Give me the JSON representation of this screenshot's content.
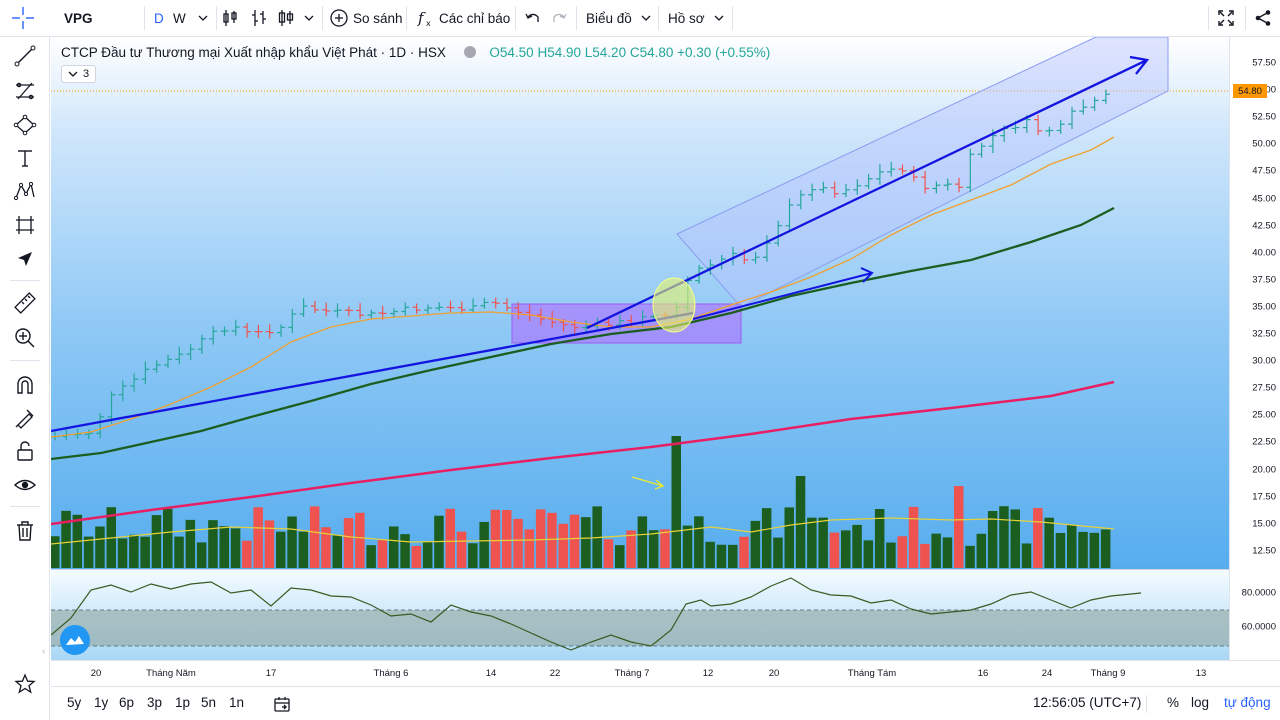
{
  "toolbar": {
    "symbol": "VPG",
    "interval_d": "D",
    "interval_w": "W",
    "compare": "So sánh",
    "indicators": "Các chỉ báo",
    "chart_type": "Biểu đồ",
    "profile": "Hồ sơ"
  },
  "legend": {
    "title": "CTCP Đầu tư Thương mại Xuất nhập khẩu Việt Phát · 1D · HSX",
    "open": "O54.50",
    "high": "H54.90",
    "low": "L54.20",
    "close": "C54.80",
    "change": "+0.30 (+0.55%)",
    "collapse_count": "3"
  },
  "price_scale": {
    "labels": [
      "57.50",
      "55.00",
      "52.50",
      "50.00",
      "47.50",
      "45.00",
      "42.50",
      "40.00",
      "37.50",
      "35.00",
      "32.50",
      "30.00",
      "27.50",
      "25.00",
      "22.50",
      "20.00",
      "17.50",
      "15.00",
      "12.50"
    ],
    "current_price": "54.80"
  },
  "osc_scale": {
    "labels": [
      "80.0000",
      "60.0000"
    ]
  },
  "time_scale": {
    "labels": [
      "20",
      "Tháng Năm",
      "17",
      "Tháng 6",
      "14",
      "22",
      "Tháng 7",
      "12",
      "20",
      "Tháng Tám",
      "16",
      "24",
      "Tháng 9",
      "13"
    ]
  },
  "bottom_bar": {
    "ranges": [
      "5y",
      "1y",
      "6p",
      "3p",
      "1p",
      "5n",
      "1n"
    ],
    "clock": "12:56:05 (UTC+7)",
    "percent": "%",
    "log": "log",
    "auto": "tự động"
  },
  "colors": {
    "up": "#26a69a",
    "down": "#ef5350",
    "accent": "#2962ff",
    "ma_fast": "#f0a030",
    "ma_mid": "#1b5e20",
    "ma_slow": "#e91e63",
    "trend": "#1414e0"
  }
}
